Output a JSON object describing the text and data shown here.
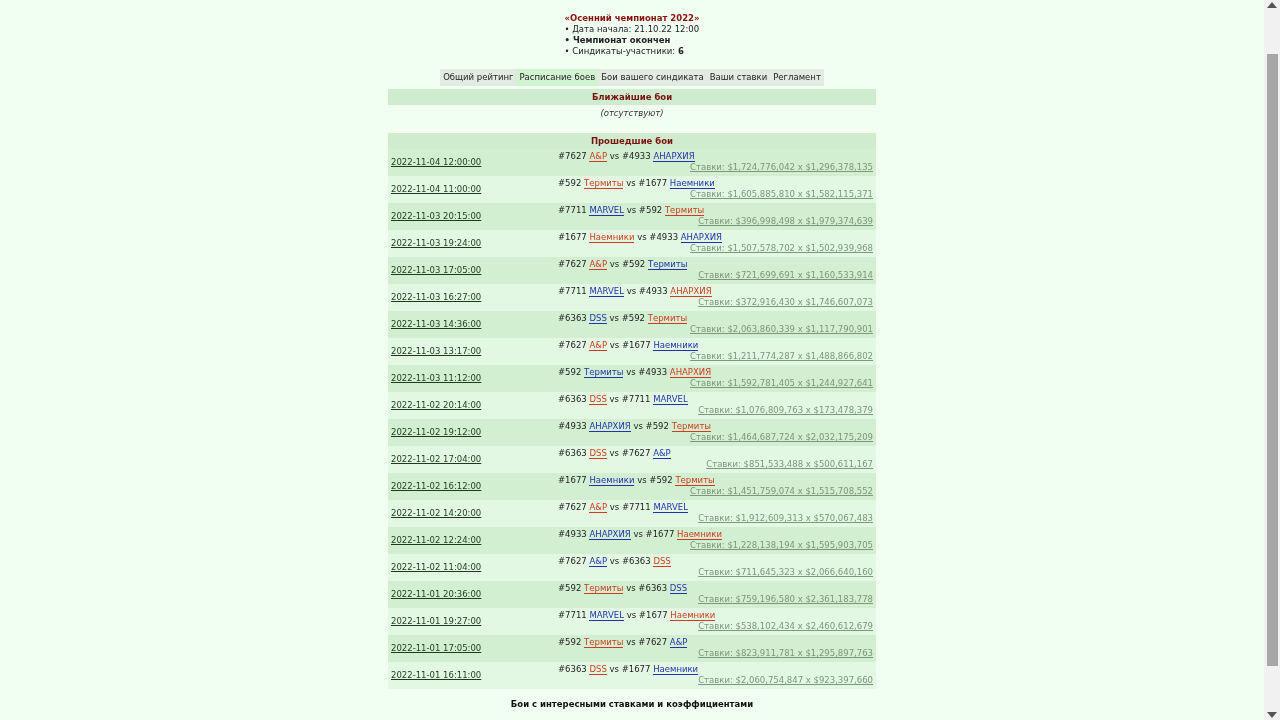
{
  "header": {
    "title": "«Осенний чемпионат 2022»",
    "info": [
      {
        "text": "• Дата начала: 21.10.22 12:00",
        "kind": "plain"
      },
      {
        "text": "• Чемпионат окончен",
        "kind": "status"
      },
      {
        "text": "• Синдикаты-участники: **6**",
        "kind": "plain"
      }
    ]
  },
  "tabs": [
    {
      "label": "Общий рейтинг",
      "selected": false
    },
    {
      "label": "Расписание боев",
      "selected": true
    },
    {
      "label": "Бои вашего синдиката",
      "selected": false
    },
    {
      "label": "Ваши ставки",
      "selected": false
    },
    {
      "label": "Регламент",
      "selected": false
    }
  ],
  "upcoming": {
    "title": "Ближайшие бои",
    "empty_text": "(отсутствуют)"
  },
  "past": {
    "title": "Прошедшие бои",
    "fights": [
      {
        "date": "2022-11-04 12:00:00",
        "team_1": {
          "number": "#7627",
          "name": "A&P",
          "color": "#d03c1e"
        },
        "vs": "vs",
        "team_2": {
          "number": "#4933",
          "name": "АНАРХИЯ",
          "color": "#2233b0"
        },
        "stakes": "Ставки: $1,724,776,042 x $1,296,378,135"
      },
      {
        "date": "2022-11-04 11:00:00",
        "team_1": {
          "number": "#592",
          "name": "Термиты",
          "color": "#d03c1e"
        },
        "vs": "vs",
        "team_2": {
          "number": "#1677",
          "name": "Наемники",
          "color": "#2233b0"
        },
        "stakes": "Ставки: $1,605,885,810 x $1,582,115,371"
      },
      {
        "date": "2022-11-03 20:15:00",
        "team_1": {
          "number": "#7711",
          "name": "MARVEL",
          "color": "#2233b0"
        },
        "vs": "vs",
        "team_2": {
          "number": "#592",
          "name": "Термиты",
          "color": "#d03c1e"
        },
        "stakes": "Ставки: $396,998,498 x $1,979,374,639"
      },
      {
        "date": "2022-11-03 19:24:00",
        "team_1": {
          "number": "#1677",
          "name": "Наемники",
          "color": "#d03c1e"
        },
        "vs": "vs",
        "team_2": {
          "number": "#4933",
          "name": "АНАРХИЯ",
          "color": "#2233b0"
        },
        "stakes": "Ставки: $1,507,578,702 x $1,502,939,968"
      },
      {
        "date": "2022-11-03 17:05:00",
        "team_1": {
          "number": "#7627",
          "name": "A&P",
          "color": "#d03c1e"
        },
        "vs": "vs",
        "team_2": {
          "number": "#592",
          "name": "Термиты",
          "color": "#2233b0"
        },
        "stakes": "Ставки: $721,699,691 x $1,160,533,914"
      },
      {
        "date": "2022-11-03 16:27:00",
        "team_1": {
          "number": "#7711",
          "name": "MARVEL",
          "color": "#2233b0"
        },
        "vs": "vs",
        "team_2": {
          "number": "#4933",
          "name": "АНАРХИЯ",
          "color": "#d03c1e"
        },
        "stakes": "Ставки: $372,916,430 x $1,746,607,073"
      },
      {
        "date": "2022-11-03 14:36:00",
        "team_1": {
          "number": "#6363",
          "name": "DSS",
          "color": "#2233b0"
        },
        "vs": "vs",
        "team_2": {
          "number": "#592",
          "name": "Термиты",
          "color": "#d03c1e"
        },
        "stakes": "Ставки: $2,063,860,339 x $1,117,790,901"
      },
      {
        "date": "2022-11-03 13:17:00",
        "team_1": {
          "number": "#7627",
          "name": "A&P",
          "color": "#d03c1e"
        },
        "vs": "vs",
        "team_2": {
          "number": "#1677",
          "name": "Наемники",
          "color": "#2233b0"
        },
        "stakes": "Ставки: $1,211,774,287 x $1,488,866,802"
      },
      {
        "date": "2022-11-03 11:12:00",
        "team_1": {
          "number": "#592",
          "name": "Термиты",
          "color": "#2233b0"
        },
        "vs": "vs",
        "team_2": {
          "number": "#4933",
          "name": "АНАРХИЯ",
          "color": "#d03c1e"
        },
        "stakes": "Ставки: $1,592,781,405 x $1,244,927,641"
      },
      {
        "date": "2022-11-02 20:14:00",
        "team_1": {
          "number": "#6363",
          "name": "DSS",
          "color": "#d03c1e"
        },
        "vs": "vs",
        "team_2": {
          "number": "#7711",
          "name": "MARVEL",
          "color": "#2233b0"
        },
        "stakes": "Ставки: $1,076,809,763 x $173,478,379"
      },
      {
        "date": "2022-11-02 19:12:00",
        "team_1": {
          "number": "#4933",
          "name": "АНАРХИЯ",
          "color": "#2233b0"
        },
        "vs": "vs",
        "team_2": {
          "number": "#592",
          "name": "Термиты",
          "color": "#d03c1e"
        },
        "stakes": "Ставки: $1,464,687,724 x $2,032,175,209"
      },
      {
        "date": "2022-11-02 17:04:00",
        "team_1": {
          "number": "#6363",
          "name": "DSS",
          "color": "#d03c1e"
        },
        "vs": "vs",
        "team_2": {
          "number": "#7627",
          "name": "A&P",
          "color": "#2233b0"
        },
        "stakes": "Ставки: $851,533,488 x $500,611,167"
      },
      {
        "date": "2022-11-02 16:12:00",
        "team_1": {
          "number": "#1677",
          "name": "Наемники",
          "color": "#2233b0"
        },
        "vs": "vs",
        "team_2": {
          "number": "#592",
          "name": "Термиты",
          "color": "#d03c1e"
        },
        "stakes": "Ставки: $1,451,759,074 x $1,515,708,552"
      },
      {
        "date": "2022-11-02 14:20:00",
        "team_1": {
          "number": "#7627",
          "name": "A&P",
          "color": "#d03c1e"
        },
        "vs": "vs",
        "team_2": {
          "number": "#7711",
          "name": "MARVEL",
          "color": "#2233b0"
        },
        "stakes": "Ставки: $1,912,609,313 x $570,067,483"
      },
      {
        "date": "2022-11-02 12:24:00",
        "team_1": {
          "number": "#4933",
          "name": "АНАРХИЯ",
          "color": "#2233b0"
        },
        "vs": "vs",
        "team_2": {
          "number": "#1677",
          "name": "Наемники",
          "color": "#d03c1e"
        },
        "stakes": "Ставки: $1,228,138,194 x $1,595,903,705"
      },
      {
        "date": "2022-11-02 11:04:00",
        "team_1": {
          "number": "#7627",
          "name": "A&P",
          "color": "#2233b0"
        },
        "vs": "vs",
        "team_2": {
          "number": "#6363",
          "name": "DSS",
          "color": "#d03c1e"
        },
        "stakes": "Ставки: $711,645,323 x $2,066,640,160"
      },
      {
        "date": "2022-11-01 20:36:00",
        "team_1": {
          "number": "#592",
          "name": "Термиты",
          "color": "#d03c1e"
        },
        "vs": "vs",
        "team_2": {
          "number": "#6363",
          "name": "DSS",
          "color": "#2233b0"
        },
        "stakes": "Ставки: $759,196,580 x $2,361,183,778"
      },
      {
        "date": "2022-11-01 19:27:00",
        "team_1": {
          "number": "#7711",
          "name": "MARVEL",
          "color": "#2233b0"
        },
        "vs": "vs",
        "team_2": {
          "number": "#1677",
          "name": "Наемники",
          "color": "#d03c1e"
        },
        "stakes": "Ставки: $538,102,434 x $2,460,612,679"
      },
      {
        "date": "2022-11-01 17:05:00",
        "team_1": {
          "number": "#592",
          "name": "Термиты",
          "color": "#d03c1e"
        },
        "vs": "vs",
        "team_2": {
          "number": "#7627",
          "name": "A&P",
          "color": "#2233b0"
        },
        "stakes": "Ставки: $823,911,781 x $1,295,897,763"
      },
      {
        "date": "2022-11-01 16:11:00",
        "team_1": {
          "number": "#6363",
          "name": "DSS",
          "color": "#d03c1e"
        },
        "vs": "vs",
        "team_2": {
          "number": "#1677",
          "name": "Наемники",
          "color": "#2233b0"
        },
        "stakes": "Ставки: $2,060,754,847 x $923,397,660"
      }
    ]
  },
  "next_section": {
    "title": "Бои с интересными ставками и коэффициентами"
  }
}
